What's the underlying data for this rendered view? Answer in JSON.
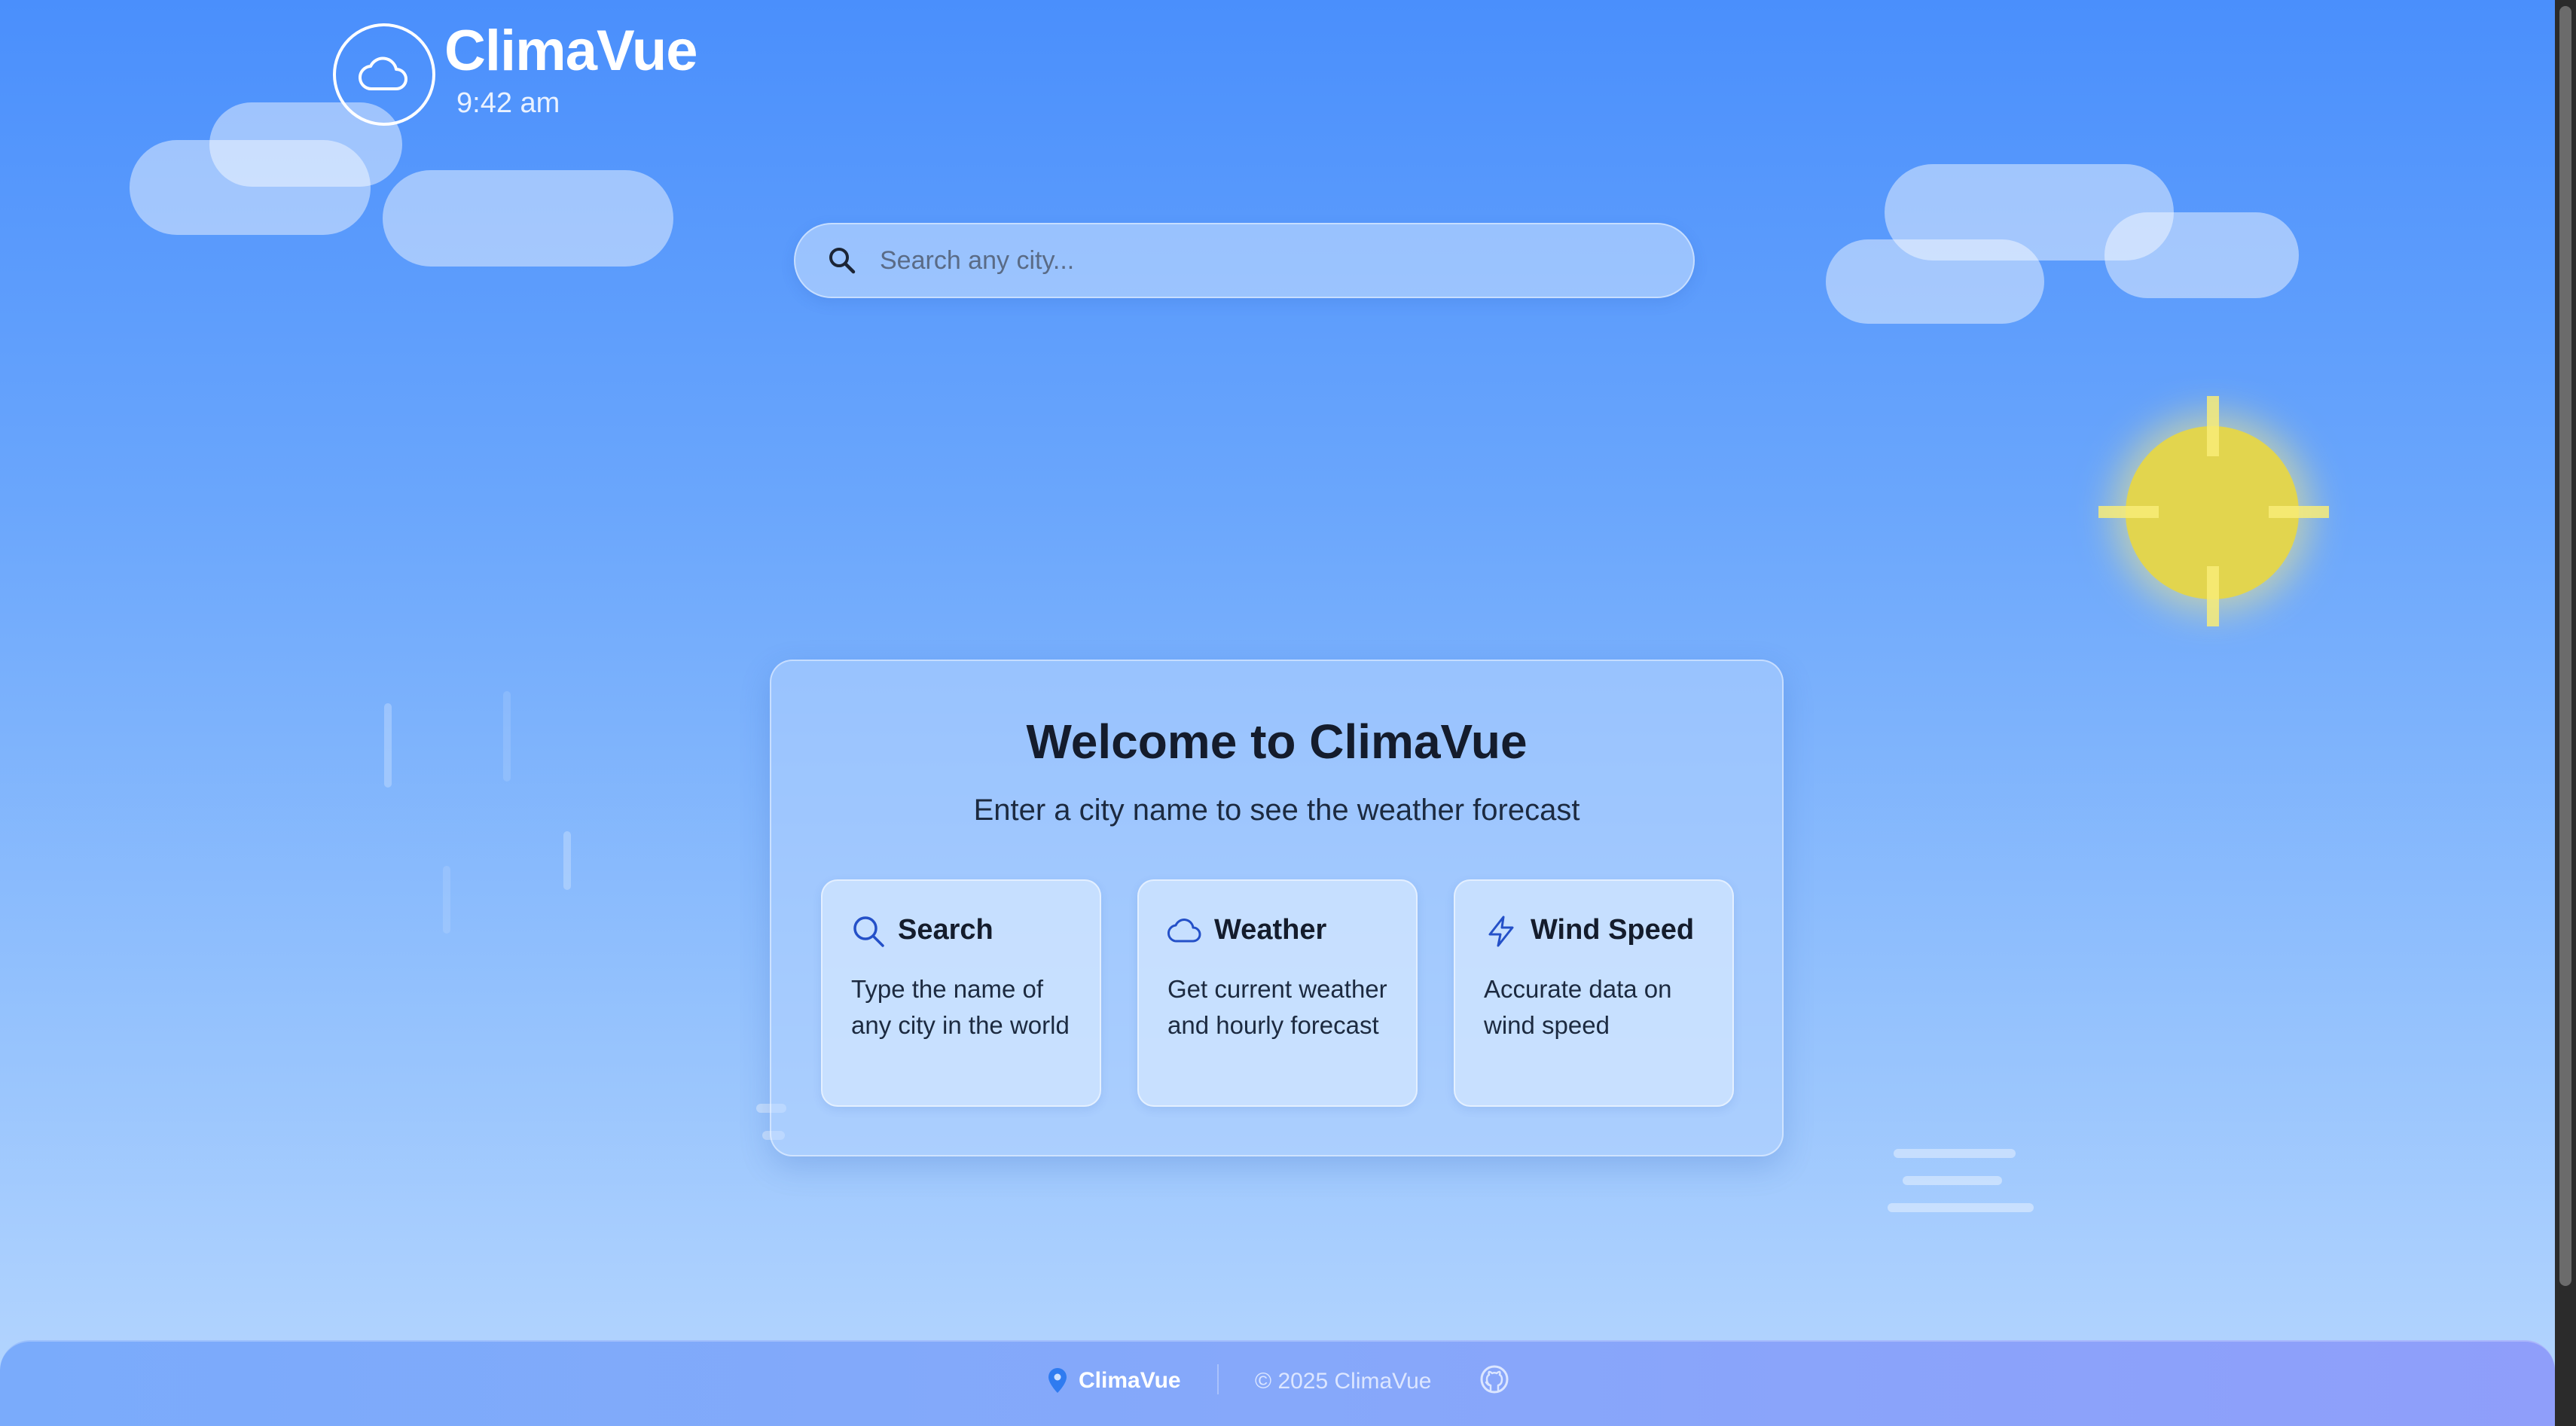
{
  "app": {
    "title": "ClimaVue",
    "time": "9:42 am"
  },
  "search": {
    "placeholder": "Search any city..."
  },
  "welcome": {
    "heading": "Welcome to ClimaVue",
    "subtitle": "Enter a city name to see the weather forecast",
    "features": [
      {
        "icon": "search-icon",
        "title": "Search",
        "description": "Type the name of any city in the world"
      },
      {
        "icon": "cloud-icon",
        "title": "Weather",
        "description": "Get current weather and hourly forecast"
      },
      {
        "icon": "lightning-icon",
        "title": "Wind Speed",
        "description": "Accurate data on wind speed"
      }
    ]
  },
  "footer": {
    "brand": "ClimaVue",
    "copyright": "© 2025 ClimaVue"
  },
  "colors": {
    "accent": "#2450c8",
    "sun": "#e2d54e"
  }
}
